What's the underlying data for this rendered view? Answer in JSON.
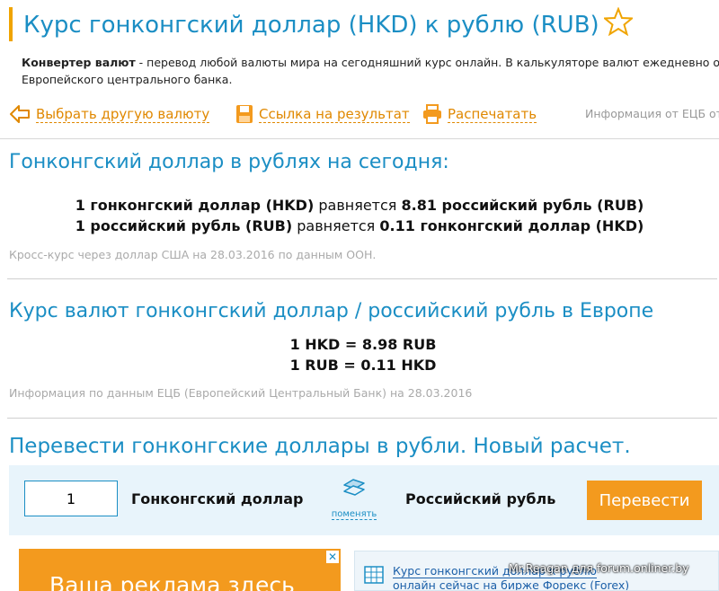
{
  "header": {
    "title": "Курс гонконгский доллар (HKD) к рублю (RUB)",
    "intro_bold": "Конвертер валют",
    "intro_line1": " - перевод любой валюты мира на сегодняшний курс онлайн. В калькуляторе валют ежедневно о",
    "intro_line2": "Европейского центрального банка."
  },
  "toolbar": {
    "choose_currency": "Выбрать другую валюту",
    "result_link": "Ссылка на результат",
    "print": "Распечатать",
    "ecb_info": "Информация от ЕЦБ от"
  },
  "today_section": {
    "title": "Гонконгский доллар в рублях на сегодня:",
    "line1": {
      "from": "1 гонконгский доллар (HKD)",
      "verb": " равняется ",
      "to": "8.81 российский рубль (RUB)"
    },
    "line2": {
      "from": "1 российский рубль (RUB)",
      "verb": " равняется ",
      "to": "0.11 гонконгский доллар (HKD)"
    },
    "note": "Кросс-курс через доллар США на 28.03.2016 по данным ООН."
  },
  "europe_section": {
    "title": "Курс валют гонконгский доллар / российский рубль в Европе",
    "line1": "1 HKD = 8.98 RUB",
    "line2": "1 RUB = 0.11 HKD",
    "note": "Информация по данным ЕЦБ (Европейский Центральный Банк) на 28.03.2016"
  },
  "converter": {
    "title": "Перевести гонконгские доллары в рубли. Новый расчет.",
    "amount": "1",
    "from_currency": "Гонконгский доллар",
    "swap_label": "поменять",
    "to_currency": "Российский рубль",
    "convert_label": "Перевести"
  },
  "ads": {
    "left_text": "Ваша реклама здесь",
    "close": "✕",
    "right_line1": "Курс гонконгский доллар к рублю",
    "right_line2": "онлайн сейчас на бирже Форекс (Forex)"
  },
  "watermark": "Mr.Reagan для forum.onliner.by",
  "colors": {
    "accent_blue": "#1b8ec4",
    "accent_orange": "#f39a1e",
    "link_orange": "#e08800"
  }
}
